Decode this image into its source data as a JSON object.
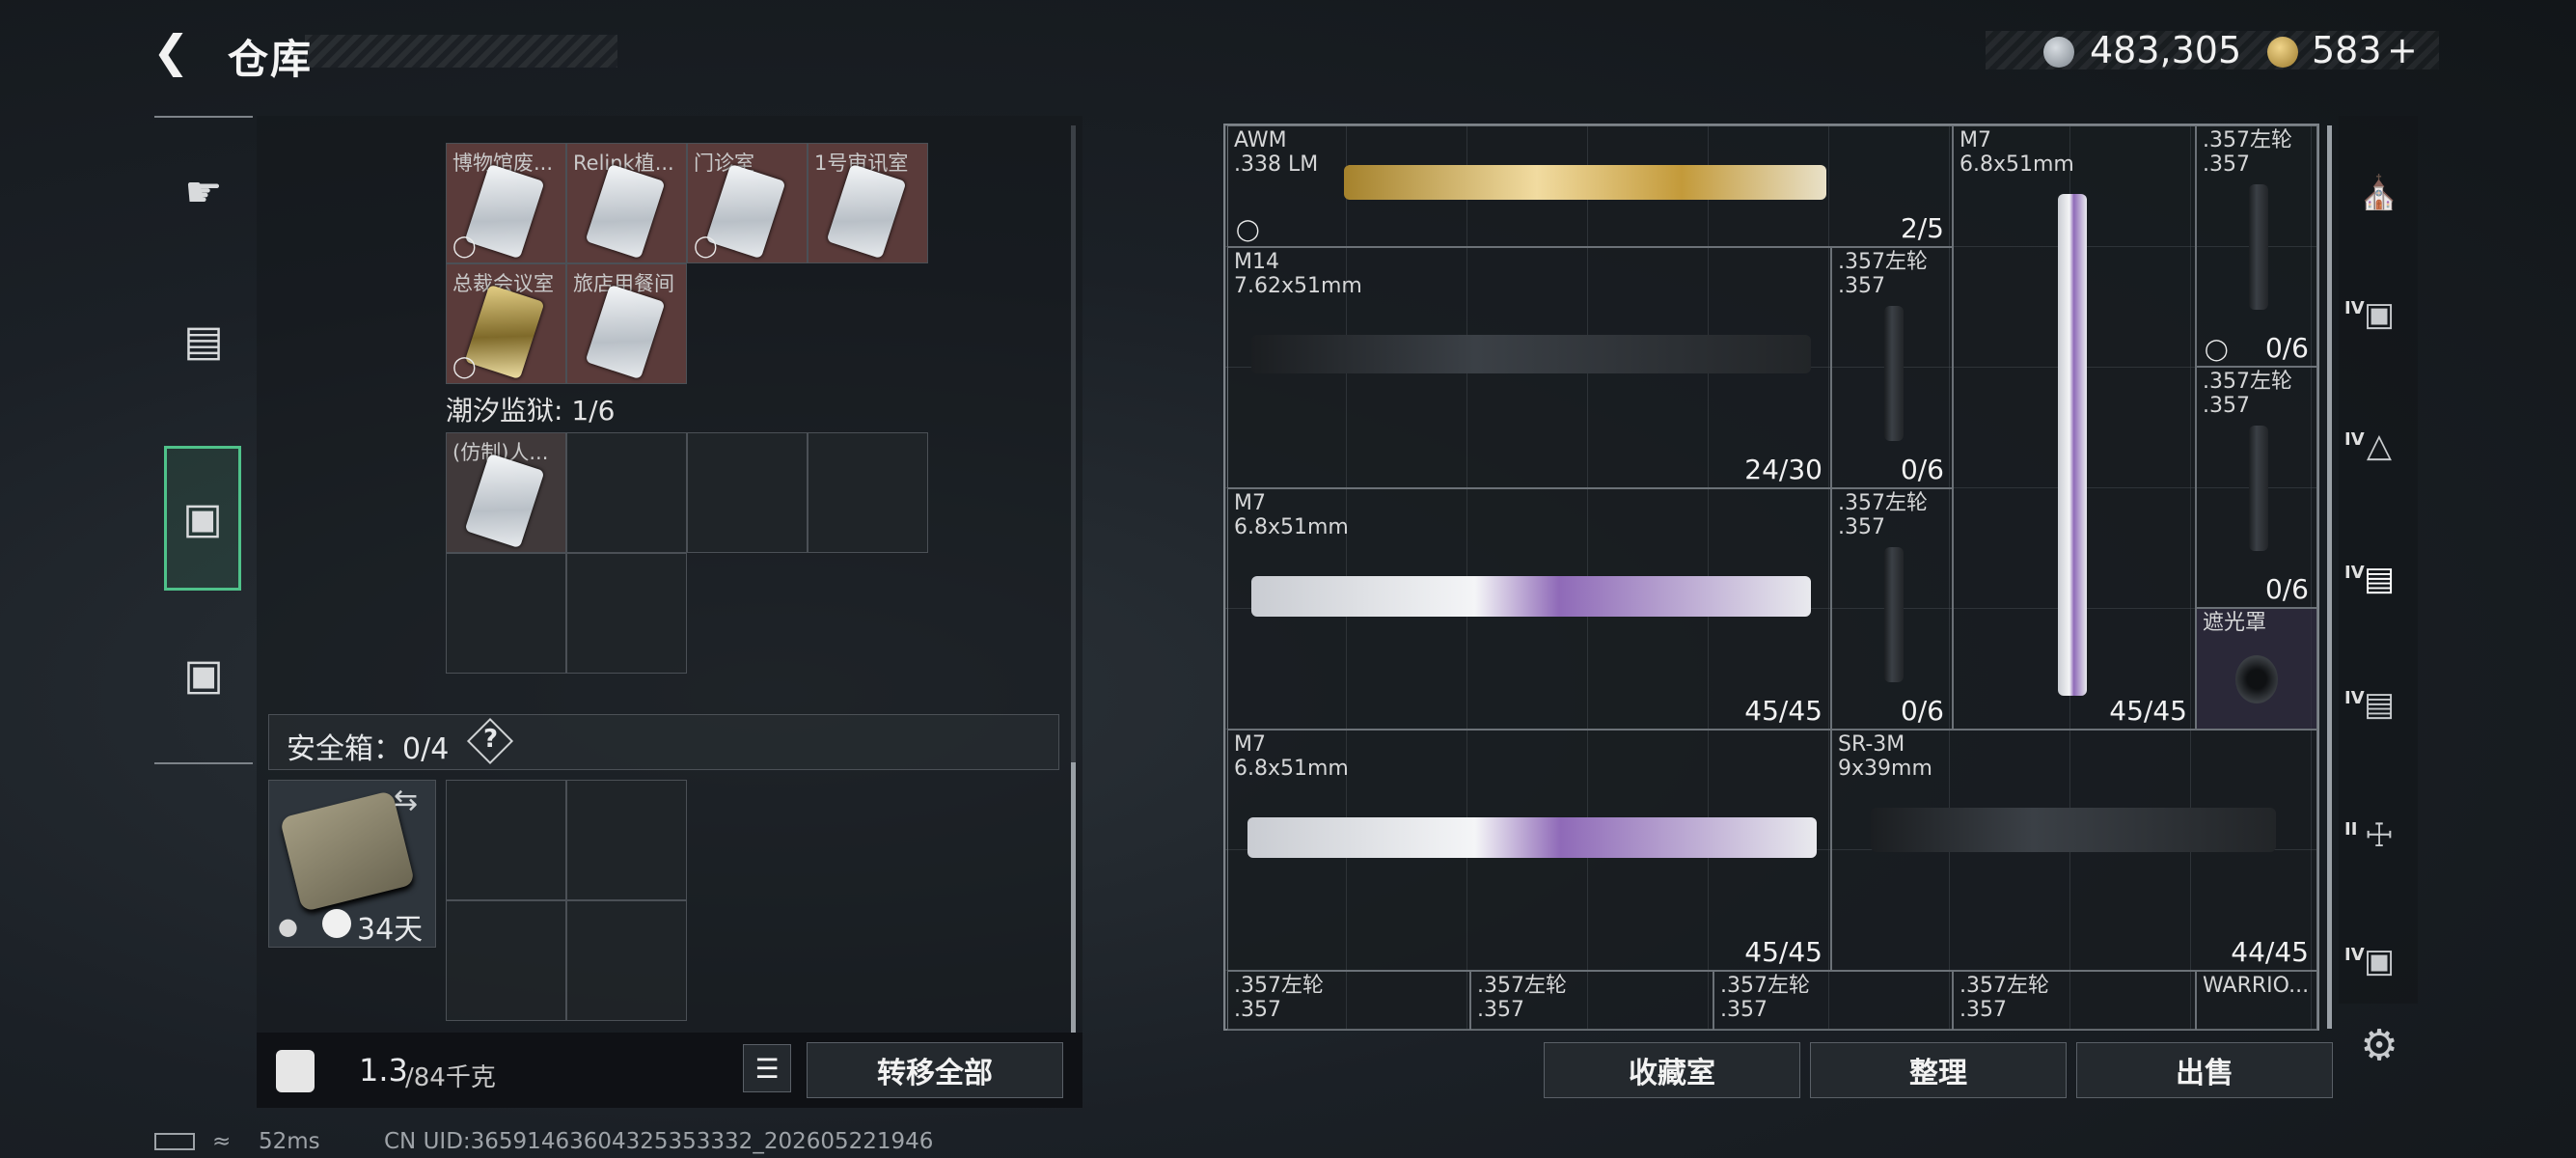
{
  "header": {
    "title": "仓库",
    "currency1": "483,305",
    "currency2": "583",
    "add_label": "+"
  },
  "left_nav": {
    "items": [
      "weapon-icon",
      "backpack-icon",
      "container-icon",
      "toolbox-icon"
    ]
  },
  "key_grid": {
    "row1": [
      "博物馆废...",
      "Relink植...",
      "门诊室",
      "1号审讯室"
    ],
    "row2": [
      "总裁会议室",
      "旅店用餐间"
    ]
  },
  "prison": {
    "label": "潮汐监狱: 1/6",
    "item": "(仿制)人..."
  },
  "safe": {
    "label": "安全箱：0/4",
    "help": "?",
    "timer": "34天"
  },
  "capacity": {
    "current": "1.3",
    "max": "/84千克"
  },
  "buttons": {
    "transfer_all": "转移全部",
    "collection": "收藏室",
    "organize": "整理",
    "sell": "出售"
  },
  "stash": {
    "items": [
      {
        "name": "AWM",
        "ammo": ".338 LM",
        "count": "2/5"
      },
      {
        "name": "M7",
        "ammo": "6.8x51mm",
        "count": "45/45"
      },
      {
        "name": ".357左轮",
        "ammo": ".357",
        "count": "0/6"
      },
      {
        "name": "M14",
        "ammo": "7.62x51mm",
        "count": "24/30"
      },
      {
        "name": ".357左轮",
        "ammo": ".357",
        "count": "0/6"
      },
      {
        "name": ".357左轮",
        "ammo": ".357",
        "count": "0/6"
      },
      {
        "name": "M7",
        "ammo": "6.8x51mm",
        "count": "45/45"
      },
      {
        "name": ".357左轮",
        "ammo": ".357",
        "count": "0/6"
      },
      {
        "name": "遮光罩",
        "ammo": "",
        "count": ""
      },
      {
        "name": "M7",
        "ammo": "6.8x51mm",
        "count": "45/45"
      },
      {
        "name": "SR-3M",
        "ammo": "9x39mm",
        "count": "44/45"
      },
      {
        "name": ".357左轮",
        "ammo": ".357",
        "count": ""
      },
      {
        "name": ".357左轮",
        "ammo": ".357",
        "count": ""
      },
      {
        "name": ".357左轮",
        "ammo": ".357",
        "count": ""
      },
      {
        "name": ".357左轮",
        "ammo": ".357",
        "count": ""
      },
      {
        "name": "WARRIO...",
        "ammo": "",
        "count": ""
      }
    ]
  },
  "right_sidebar": {
    "tiers": [
      "",
      "IV",
      "IV",
      "IV",
      "IV",
      "II",
      "IV"
    ]
  },
  "status": {
    "ping": "52ms",
    "uid": "CN UID:36591463604325353332_202605221946"
  }
}
